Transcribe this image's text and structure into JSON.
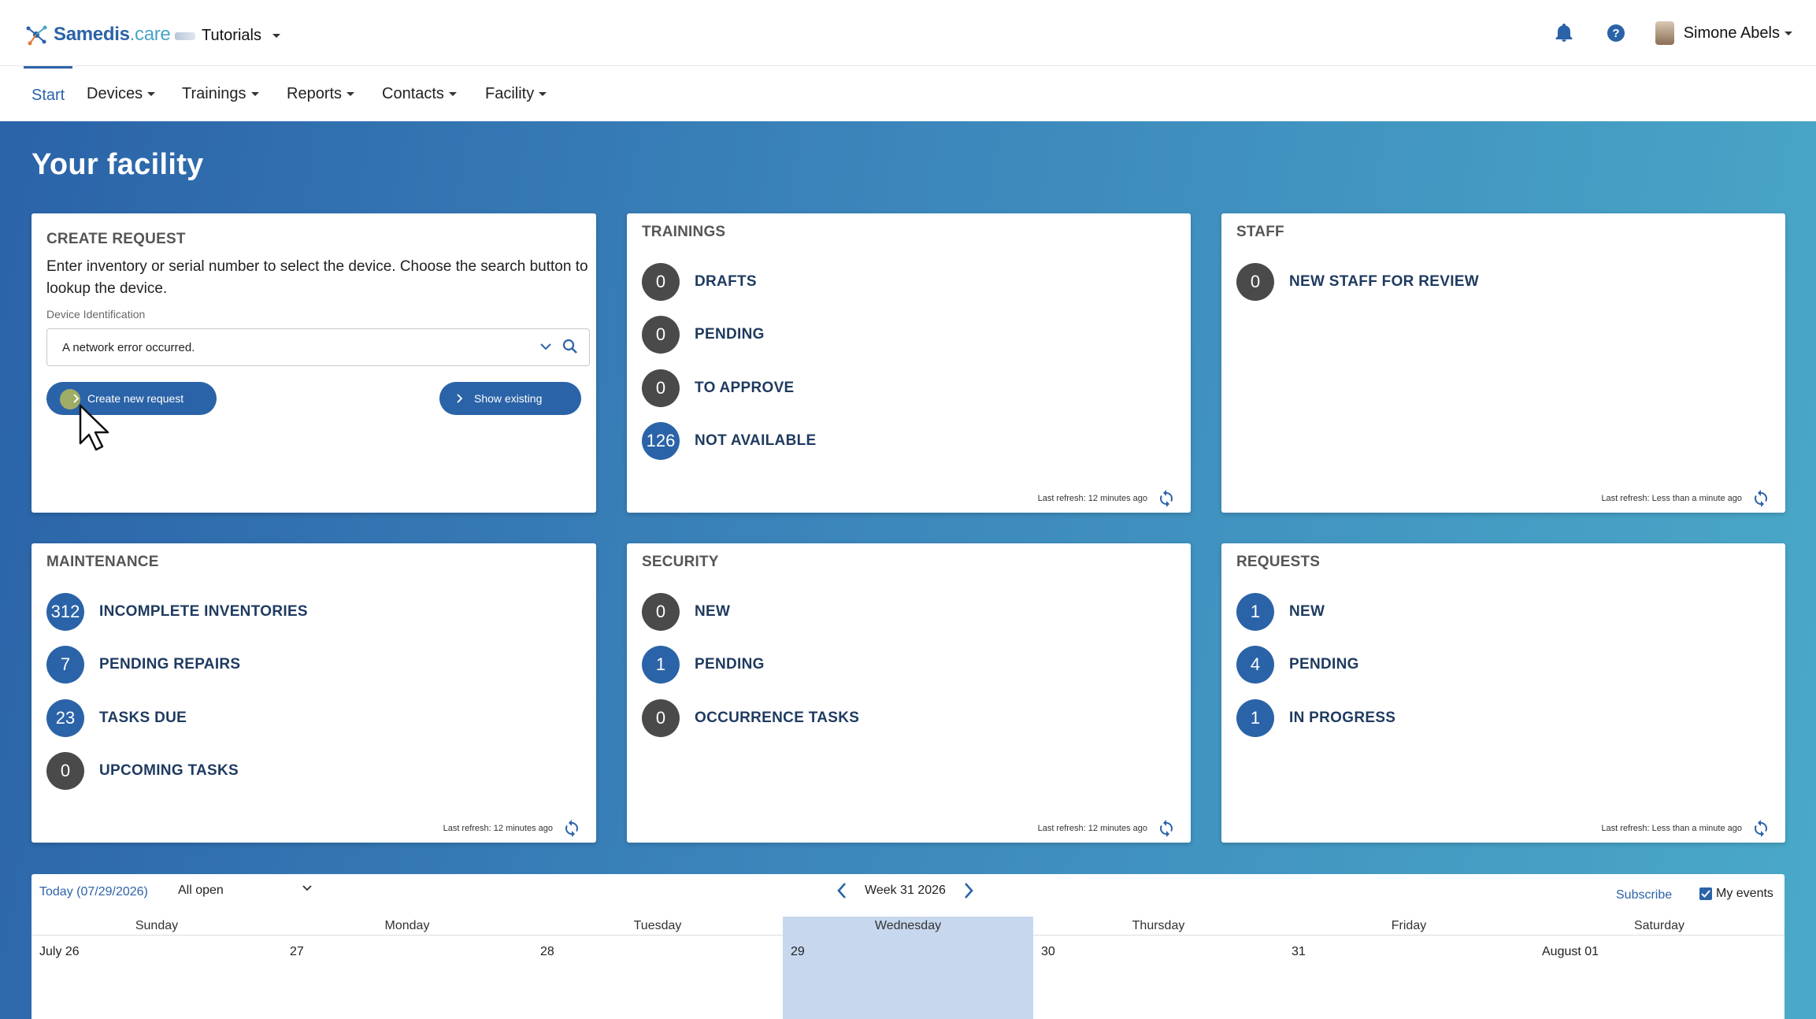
{
  "header": {
    "brand_name": "Samedis",
    "brand_suffix": ".care",
    "tenant": "Tutorials",
    "user_name": "Simone Abels"
  },
  "nav": {
    "items": [
      {
        "label": "Start",
        "active": true
      },
      {
        "label": "Devices"
      },
      {
        "label": "Trainings"
      },
      {
        "label": "Reports"
      },
      {
        "label": "Contacts"
      },
      {
        "label": "Facility"
      }
    ]
  },
  "page": {
    "title": "Your facility"
  },
  "create_request": {
    "title": "CREATE REQUEST",
    "description": "Enter inventory or serial number to select the device. Choose the search button to lookup the device.",
    "field_label": "Device Identification",
    "field_value": "A network error occurred.",
    "create_button": "Create new request",
    "show_button": "Show existing"
  },
  "trainings": {
    "title": "TRAININGS",
    "items": [
      {
        "count": "0",
        "label": "DRAFTS"
      },
      {
        "count": "0",
        "label": "PENDING"
      },
      {
        "count": "0",
        "label": "TO APPROVE"
      },
      {
        "count": "126",
        "label": "NOT AVAILABLE"
      }
    ],
    "refresh": "Last refresh: 12 minutes ago"
  },
  "staff": {
    "title": "STAFF",
    "items": [
      {
        "count": "0",
        "label": "NEW STAFF FOR REVIEW"
      }
    ],
    "refresh": "Last refresh: Less than a minute ago"
  },
  "maintenance": {
    "title": "MAINTENANCE",
    "items": [
      {
        "count": "312",
        "label": "INCOMPLETE INVENTORIES"
      },
      {
        "count": "7",
        "label": "PENDING REPAIRS"
      },
      {
        "count": "23",
        "label": "TASKS DUE"
      },
      {
        "count": "0",
        "label": "UPCOMING TASKS"
      }
    ],
    "refresh": "Last refresh: 12 minutes ago"
  },
  "security": {
    "title": "SECURITY",
    "items": [
      {
        "count": "0",
        "label": "NEW"
      },
      {
        "count": "1",
        "label": "PENDING"
      },
      {
        "count": "0",
        "label": "OCCURRENCE TASKS"
      }
    ],
    "refresh": "Last refresh: 12 minutes ago"
  },
  "requests": {
    "title": "REQUESTS",
    "items": [
      {
        "count": "1",
        "label": "NEW"
      },
      {
        "count": "4",
        "label": "PENDING"
      },
      {
        "count": "1",
        "label": "IN PROGRESS"
      }
    ],
    "refresh": "Last refresh: Less than a minute ago"
  },
  "calendar": {
    "today": "Today (07/29/2026)",
    "filter": "All open",
    "week": "Week 31 2026",
    "subscribe": "Subscribe",
    "my_events": "My events",
    "days": [
      "Sunday",
      "Monday",
      "Tuesday",
      "Wednesday",
      "Thursday",
      "Friday",
      "Saturday"
    ],
    "dates": [
      "July 26",
      "27",
      "28",
      "29",
      "30",
      "31",
      "August 01"
    ]
  },
  "colors": {
    "primary": "#2b63a8",
    "zero_badge": "#4a4a4a",
    "today_highlight": "#c6d7ee"
  }
}
